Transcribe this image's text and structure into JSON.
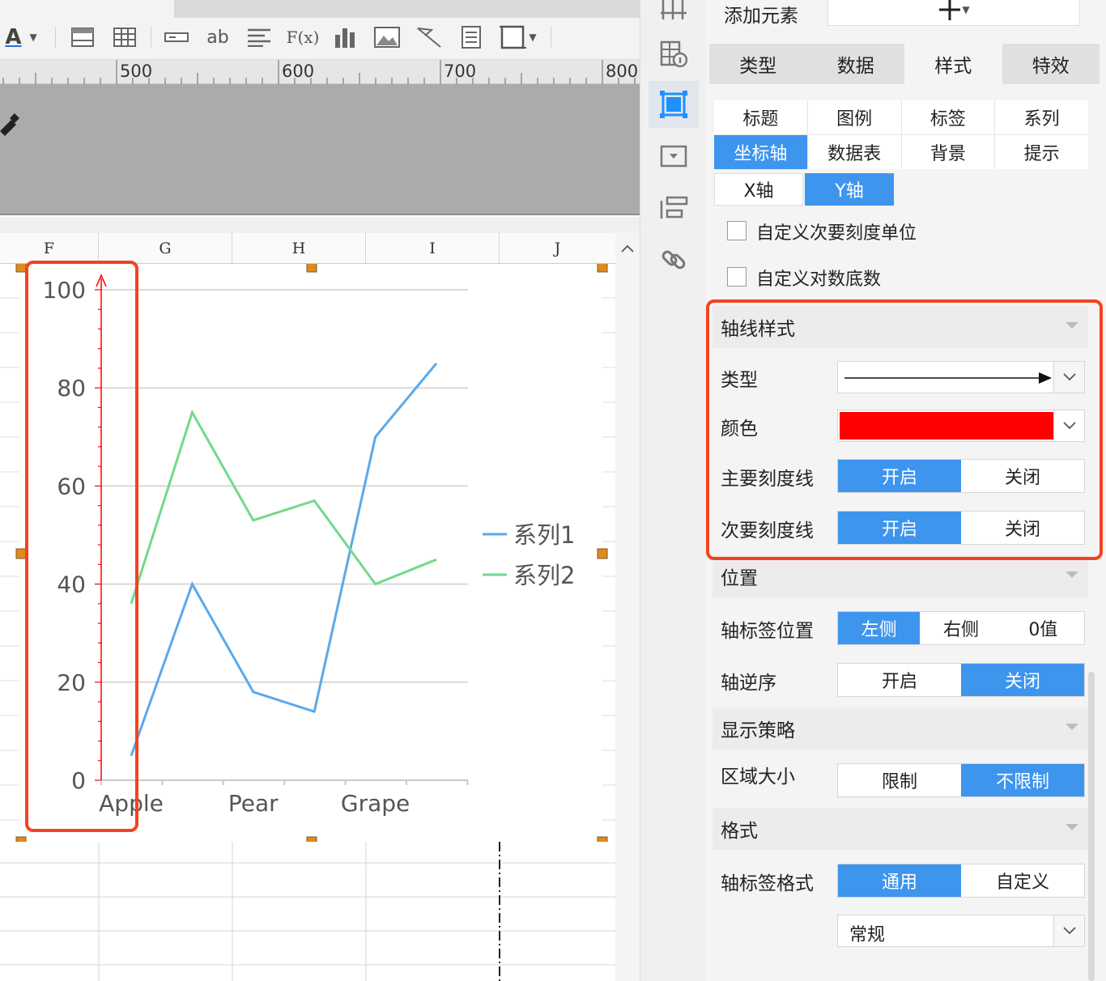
{
  "toolbar": {
    "icons": [
      "text-color-icon",
      "cell-frame-icon",
      "table-icon",
      "field-icon",
      "text-box-icon",
      "paragraph-icon",
      "formula-icon",
      "bar-chart-icon",
      "image-icon",
      "line-tool-icon",
      "document-icon",
      "border-icon"
    ],
    "text_color_glyph": "A",
    "text_box_glyph": "ab",
    "formula_glyph": "F(x)"
  },
  "ruler": {
    "marks": [
      "500",
      "600",
      "700",
      "800"
    ]
  },
  "sheet": {
    "columns": [
      "F",
      "G",
      "H",
      "I",
      "J"
    ]
  },
  "chart_data": {
    "type": "line",
    "categories": [
      "Apple",
      "",
      "Pear",
      "",
      "Grape",
      ""
    ],
    "series": [
      {
        "name": "系列1",
        "values": [
          5,
          40,
          18,
          14,
          70,
          85
        ],
        "color": "#5aa9ea"
      },
      {
        "name": "系列2",
        "values": [
          36,
          75,
          53,
          57,
          40,
          45
        ],
        "color": "#72d98a"
      }
    ],
    "yticks": [
      "0",
      "20",
      "40",
      "60",
      "80",
      "100"
    ],
    "ylim": [
      0,
      100
    ],
    "grid": true,
    "legend": "right",
    "axis_color": "#ff0000"
  },
  "panel": {
    "add_element_label": "添加元素",
    "main_tabs": [
      {
        "label": "类型",
        "active": false
      },
      {
        "label": "数据",
        "active": false
      },
      {
        "label": "样式",
        "active": true
      },
      {
        "label": "特效",
        "active": false
      }
    ],
    "sub_tabs": [
      {
        "label": "标题",
        "active": false
      },
      {
        "label": "图例",
        "active": false
      },
      {
        "label": "标签",
        "active": false
      },
      {
        "label": "系列",
        "active": false
      },
      {
        "label": "坐标轴",
        "active": true
      },
      {
        "label": "数据表",
        "active": false
      },
      {
        "label": "背景",
        "active": false
      },
      {
        "label": "提示",
        "active": false
      }
    ],
    "axis_tabs": [
      {
        "label": "X轴",
        "active": false
      },
      {
        "label": "Y轴",
        "active": true
      }
    ],
    "custom_minor_unit": "自定义次要刻度单位",
    "custom_log_base": "自定义对数底数",
    "axis_style": {
      "title": "轴线样式",
      "type_label": "类型",
      "color_label": "颜色",
      "color_value": "#ff0000",
      "major_tick_label": "主要刻度线",
      "minor_tick_label": "次要刻度线",
      "on": "开启",
      "off": "关闭"
    },
    "position": {
      "title": "位置",
      "label_pos_label": "轴标签位置",
      "left": "左侧",
      "right": "右侧",
      "zero": "0值",
      "reverse_label": "轴逆序",
      "on": "开启",
      "off": "关闭"
    },
    "display": {
      "title": "显示策略",
      "area_size_label": "区域大小",
      "limit": "限制",
      "no_limit": "不限制"
    },
    "format": {
      "title": "格式",
      "label_format_label": "轴标签格式",
      "general": "通用",
      "custom": "自定义",
      "select_value": "常规"
    }
  }
}
